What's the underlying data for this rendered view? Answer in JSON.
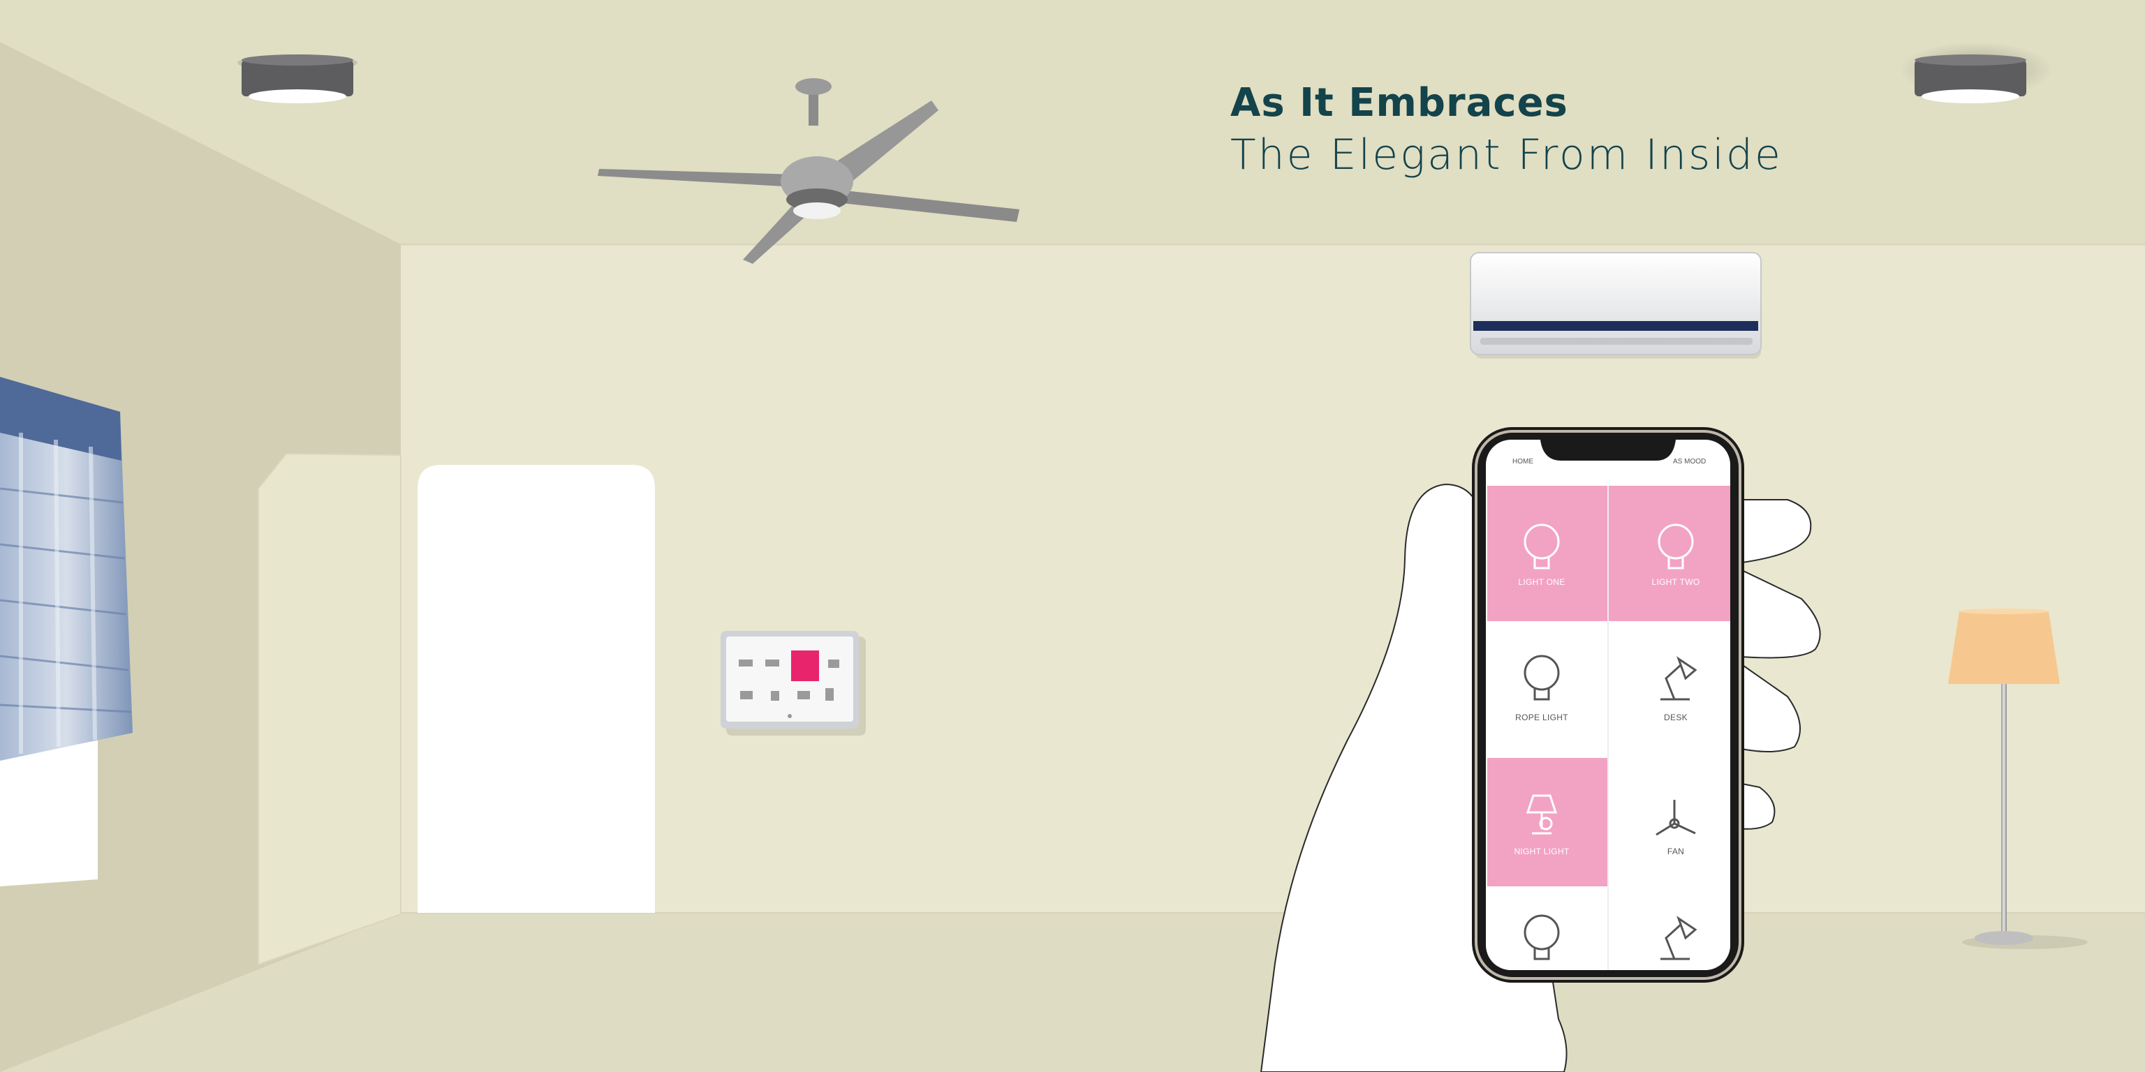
{
  "headline": {
    "line1": "As It Embraces",
    "line2": "The Elegant From Inside"
  },
  "colors": {
    "ceiling": "#e0dec3",
    "back_wall": "#e9e7cf",
    "side_wall": "#d2cfb4",
    "floor": "#dedcc2",
    "door": "#ffffff",
    "headline": "#13434b",
    "tile_active": "#f2a3c3",
    "tile_inactive": "#ffffff",
    "lamp_shade": "#f6c88f",
    "panel_active": "#e8256c"
  },
  "objects": {
    "ceiling_light_left": "ceiling-light-icon",
    "ceiling_light_right": "ceiling-light-icon",
    "ceiling_fan": "ceiling-fan-icon",
    "air_conditioner": "air-conditioner-icon",
    "wall_panel": "touch-panel-icon",
    "floor_lamp": "floor-lamp-icon",
    "window_blind": "roman-blind-icon"
  },
  "phone": {
    "nav_left": "HOME",
    "nav_right": "AS MOOD",
    "tiles": [
      {
        "label": "LIGHT ONE",
        "icon": "bulb-icon",
        "active": true
      },
      {
        "label": "LIGHT TWO",
        "icon": "bulb-icon",
        "active": true
      },
      {
        "label": "ROPE LIGHT",
        "icon": "bulb-icon",
        "active": false
      },
      {
        "label": "DESK",
        "icon": "desk-lamp-icon",
        "active": false
      },
      {
        "label": "NIGHT LIGHT",
        "icon": "table-lamp-icon",
        "active": true
      },
      {
        "label": "FAN",
        "icon": "fan-icon",
        "active": false
      },
      {
        "label": "",
        "icon": "bulb-icon",
        "active": false
      },
      {
        "label": "",
        "icon": "desk-lamp-icon",
        "active": false
      }
    ]
  }
}
